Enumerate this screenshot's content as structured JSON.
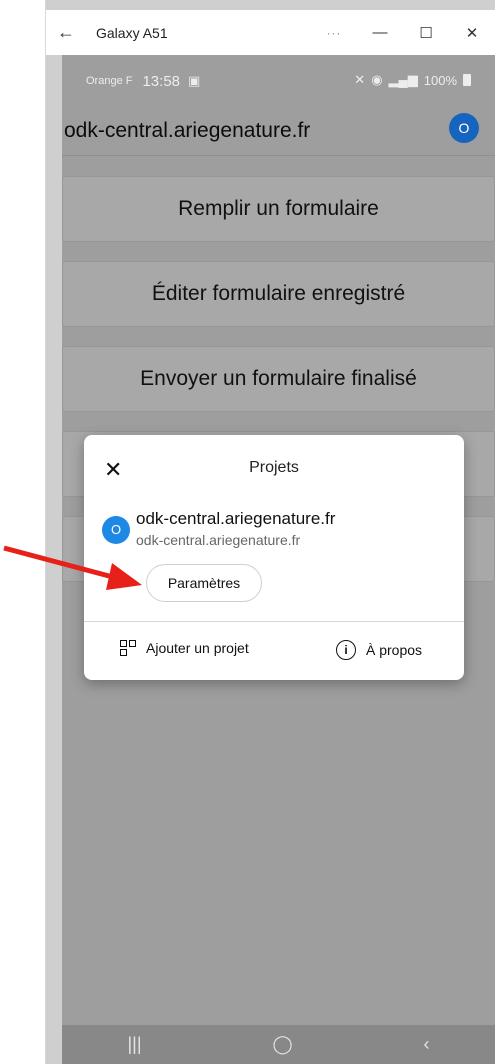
{
  "window": {
    "title": "Galaxy A51",
    "controls": {
      "more": "···",
      "minimize": "—",
      "maximize": "☐",
      "close": "✕"
    },
    "back": "←"
  },
  "statusbar": {
    "carrier": "Orange F",
    "time": "13:58",
    "battery": "100%"
  },
  "appbar": {
    "title": "odk-central.ariegenature.fr",
    "avatar": "O"
  },
  "menu": [
    {
      "label": "Remplir un formulaire"
    },
    {
      "label": "Éditer formulaire enregistré"
    },
    {
      "label": "Envoyer un formulaire finalisé"
    }
  ],
  "dialog": {
    "close": "✕",
    "title": "Projets",
    "project": {
      "avatar": "O",
      "name": "odk-central.ariegenature.fr",
      "url": "odk-central.ariegenature.fr"
    },
    "settings_button": "Paramètres",
    "add_project": "Ajouter un projet",
    "about": "À propos"
  },
  "navbar": {
    "recent": "|||",
    "home": "◯",
    "back": "‹"
  },
  "colors": {
    "accent": "#1e88e5",
    "arrow": "#e8201a",
    "overlay": "#9e9e9e"
  }
}
